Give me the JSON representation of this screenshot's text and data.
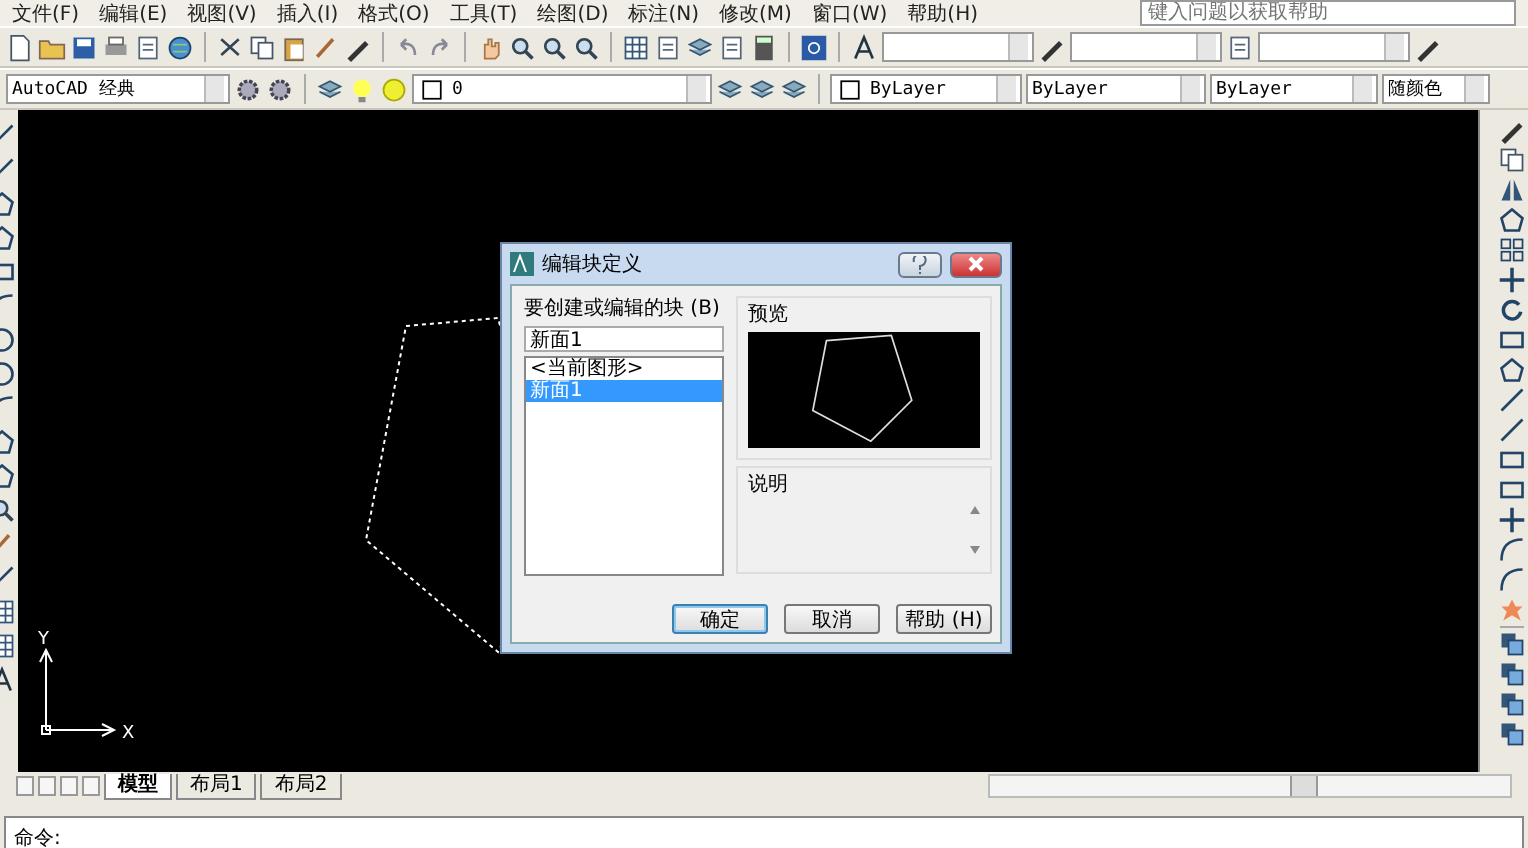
{
  "menu_bar": {
    "items": [
      "文件(F)",
      "编辑(E)",
      "视图(V)",
      "插入(I)",
      "格式(O)",
      "工具(T)",
      "绘图(D)",
      "标注(N)",
      "修改(M)",
      "窗口(W)",
      "帮助(H)"
    ]
  },
  "help_search": {
    "placeholder": "键入问题以获取帮助"
  },
  "toolbar": {
    "workspace": "AutoCAD 经典",
    "layer": "0",
    "color_control": "ByLayer",
    "linetype": "ByLayer",
    "lineweight": "ByLayer",
    "plot_style": "随颜色"
  },
  "dialog": {
    "title": "编辑块定义",
    "list_label": "要创建或编辑的块 (B)",
    "block_name": "新面1",
    "blocks": [
      {
        "label": "<当前图形>",
        "selected": false
      },
      {
        "label": "新面1",
        "selected": true
      }
    ],
    "preview_label": "预览",
    "description_label": "说明",
    "buttons": [
      {
        "label": "确定",
        "default": true
      },
      {
        "label": "取消",
        "default": false
      },
      {
        "label": "帮助 (H)",
        "default": false
      }
    ]
  },
  "layout_tabs": [
    {
      "label": "模型",
      "selected": true
    },
    {
      "label": "布局1",
      "selected": false
    },
    {
      "label": "布局2",
      "selected": false
    }
  ],
  "ucs_icon": {
    "y_label": "Y",
    "x_label": "X"
  },
  "command_line": {
    "prompt": "命令:"
  }
}
